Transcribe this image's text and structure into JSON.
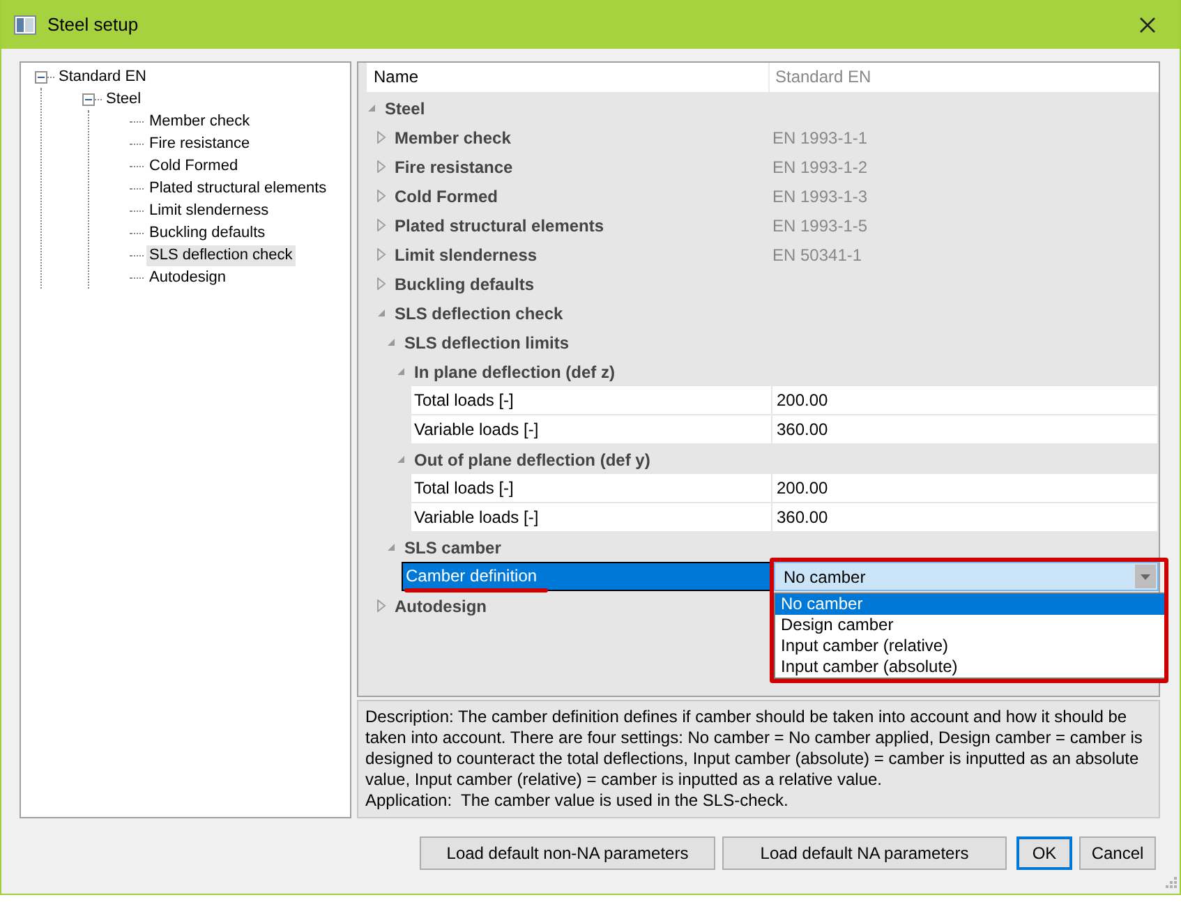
{
  "window": {
    "title": "Steel setup"
  },
  "tree": [
    {
      "label": "Standard EN",
      "expanded": true,
      "selected": false,
      "children": [
        {
          "label": "Steel",
          "expanded": true,
          "selected": false,
          "children": [
            {
              "label": "Member check",
              "selected": false
            },
            {
              "label": "Fire resistance",
              "selected": false
            },
            {
              "label": "Cold Formed",
              "selected": false
            },
            {
              "label": "Plated structural elements",
              "selected": false
            },
            {
              "label": "Limit slenderness",
              "selected": false
            },
            {
              "label": "Buckling defaults",
              "selected": false
            },
            {
              "label": "SLS deflection check",
              "selected": true
            },
            {
              "label": "Autodesign",
              "selected": false
            }
          ]
        }
      ]
    }
  ],
  "grid": {
    "header": {
      "name": "Name",
      "value": "Standard EN"
    },
    "rows": [
      {
        "kind": "group",
        "label": "Steel",
        "expanded": true,
        "children": [
          {
            "kind": "group",
            "label": "Member check",
            "value": "EN 1993-1-1",
            "expanded": false
          },
          {
            "kind": "group",
            "label": "Fire resistance",
            "value": "EN 1993-1-2",
            "expanded": false
          },
          {
            "kind": "group",
            "label": "Cold Formed",
            "value": "EN 1993-1-3",
            "expanded": false
          },
          {
            "kind": "group",
            "label": "Plated structural elements",
            "value": "EN 1993-1-5",
            "expanded": false
          },
          {
            "kind": "group",
            "label": "Limit slenderness",
            "value": "EN 50341-1",
            "expanded": false
          },
          {
            "kind": "group",
            "label": "Buckling defaults",
            "expanded": false
          },
          {
            "kind": "group",
            "label": "SLS deflection check",
            "expanded": true,
            "children": [
              {
                "kind": "group",
                "label": "SLS deflection limits",
                "expanded": true,
                "children": [
                  {
                    "kind": "group",
                    "label": "In plane deflection (def z)",
                    "expanded": true,
                    "children": [
                      {
                        "kind": "field",
                        "label": "Total loads [-]",
                        "value": "200.00",
                        "selected": false
                      },
                      {
                        "kind": "field",
                        "label": "Variable loads [-]",
                        "value": "360.00",
                        "selected": false
                      }
                    ]
                  },
                  {
                    "kind": "group",
                    "label": "Out of plane deflection (def y)",
                    "expanded": true,
                    "children": [
                      {
                        "kind": "field",
                        "label": "Total loads [-]",
                        "value": "200.00",
                        "selected": false
                      },
                      {
                        "kind": "field",
                        "label": "Variable loads [-]",
                        "value": "360.00",
                        "selected": false
                      }
                    ]
                  }
                ]
              },
              {
                "kind": "group",
                "label": "SLS camber",
                "expanded": true,
                "children": [
                  {
                    "kind": "dropdown",
                    "label": "Camber definition",
                    "value": "No camber",
                    "selected": true,
                    "open": true,
                    "options": [
                      {
                        "label": "No camber",
                        "selected": true
                      },
                      {
                        "label": "Design camber",
                        "selected": false
                      },
                      {
                        "label": "Input camber (relative)",
                        "selected": false
                      },
                      {
                        "label": "Input camber (absolute)",
                        "selected": false
                      }
                    ]
                  }
                ]
              }
            ]
          },
          {
            "kind": "group",
            "label": "Autodesign",
            "expanded": false
          }
        ]
      }
    ]
  },
  "description": [
    "Description: The camber definition defines if camber should be taken into account and how it should be taken into account. There are four settings: No camber = No camber applied, Design camber = camber is designed to counteract the total deflections, Input camber (absolute) = camber is inputted as an absolute value, Input camber (relative) = camber is inputted as a relative value.",
    "Application:  The camber value is used in the SLS-check."
  ],
  "buttons": [
    {
      "label": "Load default non-NA parameters",
      "default": false
    },
    {
      "label": "Load default NA parameters",
      "default": false
    },
    {
      "label": "OK",
      "default": true
    },
    {
      "label": "Cancel",
      "default": false
    }
  ]
}
